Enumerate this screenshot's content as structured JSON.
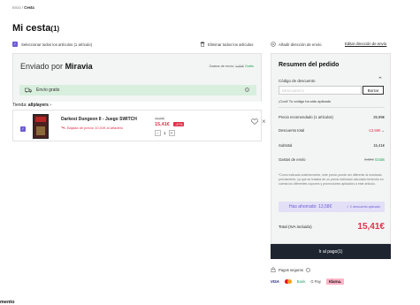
{
  "breadcrumb": {
    "home": "Inicio",
    "sep": "/",
    "current": "Cesta"
  },
  "page": {
    "title": "Mi cesta",
    "count": "(1)"
  },
  "cart": {
    "select_all_label": "Seleccionar todos los artículos (1 artículo)",
    "delete_all_label": "Eliminar todos los artículos",
    "shipping": {
      "title_prefix": "Enviado por",
      "title_brand": "Miravia",
      "cost_label": "Gastos de envío:",
      "cost_old": "0,89€",
      "cost_free": "Gratis"
    },
    "free_shipping_label": "Envío gratis",
    "store": {
      "label": "Tienda:",
      "name": "allplayers",
      "arrow": "›"
    },
    "item": {
      "name": "Darkest Dungeon II - Juego SWITCH",
      "price_drop": "Bajada de precio 10,01€ al añadirlo",
      "old_price": "25,99€",
      "price": "15,41€",
      "discount": "-47%",
      "quantity": "1",
      "minus": "−",
      "plus": "+"
    }
  },
  "address": {
    "label": "Añadir dirección de envío",
    "edit_link": "Editar dirección de envío"
  },
  "summary": {
    "title": "Resumen del pedido",
    "code_label": "Código de descuento",
    "code_placeholder": "DESCUENTO",
    "code_button": "Borrar",
    "code_applied": "¡Cool! Tu código ha sido aplicado",
    "recommended_label": "Precio recomendado (1 artículos)",
    "recommended_value": "25,99€",
    "discount_label": "Descuento total",
    "discount_value": "-13,58€",
    "subtotal_label": "Subtotal",
    "subtotal_value": "15,41€",
    "shipping_label": "Gastos de envío",
    "shipping_old": "0,89€",
    "shipping_value": "Gratis",
    "note": "*Como indicado anteriormente, este precio puede ser diferente al mostrado previamente, ya que se trataba de un precio estimado calculado teniendo en cuenta los diferentes cupones y promociones aplicados a este artículo.",
    "saved_label": "Has ahorrado: 13,58€",
    "saved_badge": "✓ 2 descuento aplicado",
    "total_label": "Total (IVA incluido)",
    "total_value": "15,41€",
    "pay_button": "Ir al pago(1)"
  },
  "payments": {
    "secure_label": "Pagos seguros",
    "visa": "VISA",
    "bank": "Bank",
    "gpay": "G Pay",
    "klarna": "Klarna."
  },
  "bottom_text": "mento",
  "colors": {
    "accent": "#6b5cd3",
    "price_red": "#e0314b",
    "free_green": "#22a05a",
    "pay_button": "#1e2430"
  },
  "icons": [
    "checkbox-icon",
    "trash-icon",
    "location-icon",
    "truck-icon",
    "info-icon",
    "heart-icon",
    "close-icon",
    "chevron-up-icon",
    "chevron-down-icon",
    "lock-icon",
    "arrow-down-icon"
  ]
}
